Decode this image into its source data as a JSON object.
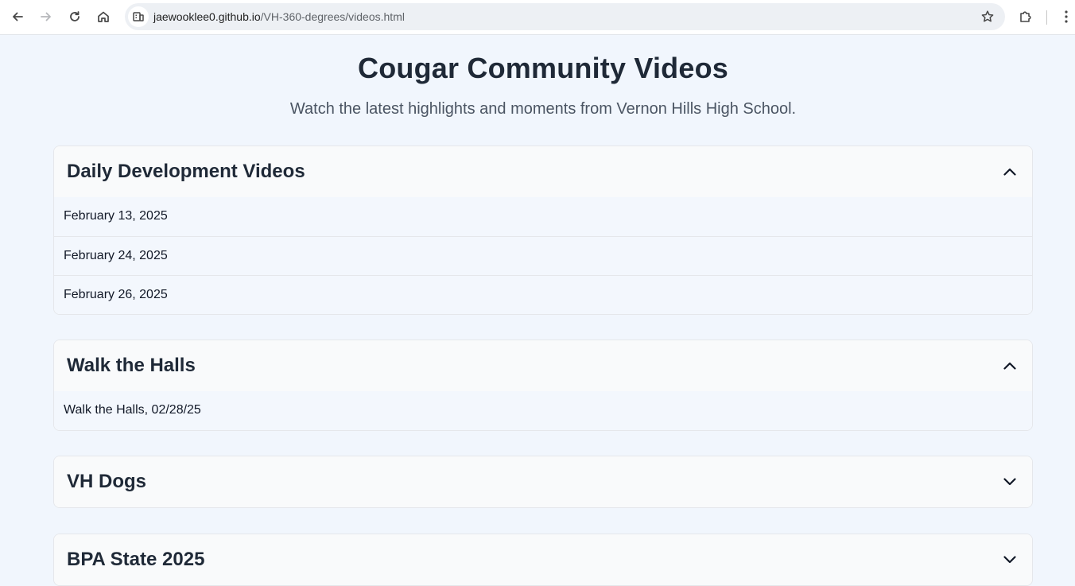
{
  "browser": {
    "url_host": "jaewooklee0.github.io",
    "url_path": "/VH-360-degrees/videos.html",
    "icons": {
      "back": "back-arrow-icon",
      "forward": "forward-arrow-icon",
      "reload": "reload-icon",
      "home": "home-icon",
      "site_info": "site-info-icon",
      "bookmark": "star-icon",
      "extensions": "puzzle-icon",
      "menu": "kebab-menu-icon"
    }
  },
  "page": {
    "title": "Cougar Community Videos",
    "subtitle": "Watch the latest highlights and moments from Vernon Hills High School."
  },
  "sections": [
    {
      "title": "Daily Development Videos",
      "expanded": true,
      "items": [
        "February 13, 2025",
        "February 24, 2025",
        "February 26, 2025"
      ]
    },
    {
      "title": "Walk the Halls",
      "expanded": true,
      "items": [
        "Walk the Halls, 02/28/25"
      ]
    },
    {
      "title": "VH Dogs",
      "expanded": false,
      "items": []
    },
    {
      "title": "BPA State 2025",
      "expanded": false,
      "items": []
    }
  ],
  "colors": {
    "page_bg": "#f1f6fd",
    "heading": "#1f2937",
    "subtitle": "#4b5563",
    "section_border": "#e5e7eb"
  }
}
